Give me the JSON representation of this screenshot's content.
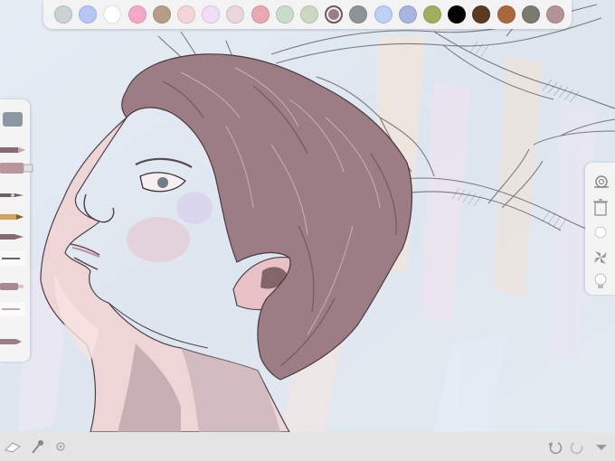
{
  "palette": {
    "colors": [
      "#c9d2d4",
      "#b6c6f5",
      "#ffffff",
      "#f4a8c8",
      "#b79d86",
      "#f4d4d8",
      "#f2dff7",
      "#e9d7dd",
      "#e7a8b2",
      "#c9dcc9",
      "#cbd9c0",
      "#9d7d84",
      "#8c949a",
      "#bdd0f5",
      "#a6b6e0",
      "#a3ad5e",
      "#000000",
      "#5a3a22",
      "#a9693c",
      "#7c7a70",
      "#b49296"
    ],
    "selected_index": 11
  },
  "left_toolbar": {
    "icons": [
      "color-chip-icon",
      "pencil-tool-icon",
      "marker-tool-icon",
      "fountain-pen-tool-icon",
      "crayon-tool-icon",
      "brush-tool-icon",
      "eraser-tool-icon",
      "airbrush-tool-icon",
      "smudge-tool-icon",
      "pencil-eraser-tool-icon"
    ],
    "selected_tool": "marker"
  },
  "right_toolbar": {
    "icons": [
      "undo-snail-icon",
      "trash-icon",
      "brush-size-dot-icon",
      "fan-icon",
      "bulb-icon"
    ]
  },
  "bottom_bar": {
    "left_icons": [
      "eraser-icon",
      "eyedropper-icon",
      "settings-gear-icon"
    ],
    "right_icons": [
      "undo-icon",
      "redo-icon",
      "menu-dropdown-icon"
    ]
  },
  "colors": {
    "hair": "#9d7d84",
    "skin": "#efd6d6",
    "line": "#4a4044",
    "canvas_bg": "#dfe6ee"
  }
}
